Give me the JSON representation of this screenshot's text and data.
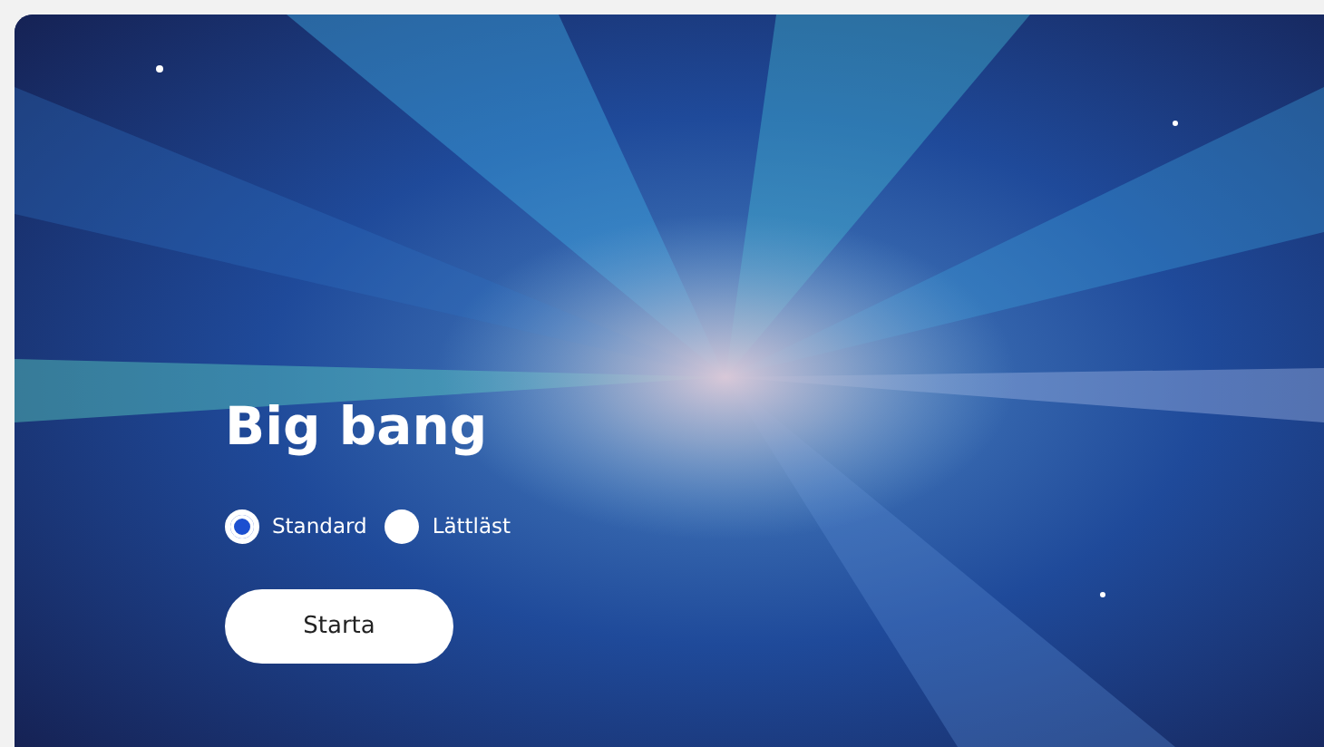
{
  "hero": {
    "title": "Big bang",
    "options": [
      {
        "label": "Standard",
        "selected": true
      },
      {
        "label": "Lättläst",
        "selected": false
      }
    ],
    "button": "Starta"
  }
}
